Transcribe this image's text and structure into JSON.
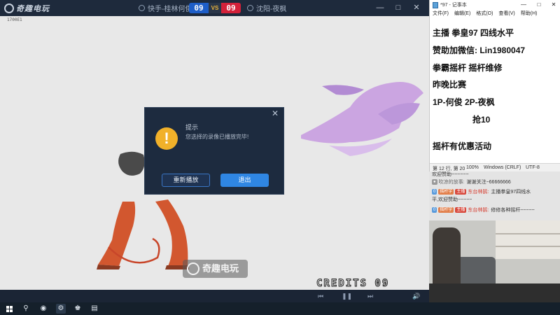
{
  "game_window": {
    "logo_text": "奇趣电玩",
    "player1": "快手-桂林何俊",
    "player2": "沈阳-夜枫",
    "score1": "09",
    "vs": "VS",
    "score2": "09",
    "top_left_tag": "1700E1",
    "credits_text": "CREDITS 09",
    "watermark_text": "奇趣电玩",
    "controls": {
      "minimize": "—",
      "maximize": "□",
      "close": "✕"
    },
    "bottom_controls": {
      "rewind": "⏮",
      "pause": "❚❚",
      "forward": "⏭",
      "volume": "🔊"
    }
  },
  "dialog": {
    "title": "提示",
    "message": "您选择的录像已播放完毕!",
    "replay_label": "重新播放",
    "exit_label": "退出",
    "close_glyph": "✕",
    "icon_glyph": "!",
    "accent_color": "#2f86e3",
    "warning_color": "#f1b12a"
  },
  "notepad": {
    "title": "*97 - 记事本",
    "menus": [
      "文件(F)",
      "编辑(E)",
      "格式(O)",
      "查看(V)",
      "帮助(H)"
    ],
    "lines": [
      "主播 拳皇97 四线水平",
      "赞助加微信:  Lin1980047",
      "拳霸摇杆  摇杆维修",
      "昨晚比赛",
      "1P-何俊          2P-夜枫",
      "抢10",
      "摇杆有优惠活动"
    ],
    "status": {
      "position": "第 12 行, 第 20",
      "zoom": "100%",
      "line_ending": "Windows (CRLF)",
      "encoding": "UTF-8"
    }
  },
  "chat": {
    "messages": [
      {
        "user": "",
        "text": "欢迎赞助~~~~~~"
      },
      {
        "user": "吹凉的放事:",
        "text": "谢谢关注~66666666"
      },
      {
        "badge_level": "0",
        "badge_fan": "摇杆宇",
        "badge_role": "主播",
        "user": "东台林鹄:",
        "text": "主播拳皇97四线水"
      },
      {
        "user": "",
        "text": "平,欢迎赞助~~~~~"
      },
      {
        "badge_level": "0",
        "badge_fan": "摇杆宇",
        "badge_role": "主播",
        "user": "东台林鹄:",
        "text": "修修各种摇杆~~~~~"
      }
    ]
  },
  "taskbar": {
    "items": [
      "start",
      "search",
      "edge",
      "qq",
      "game",
      "notepad"
    ]
  }
}
